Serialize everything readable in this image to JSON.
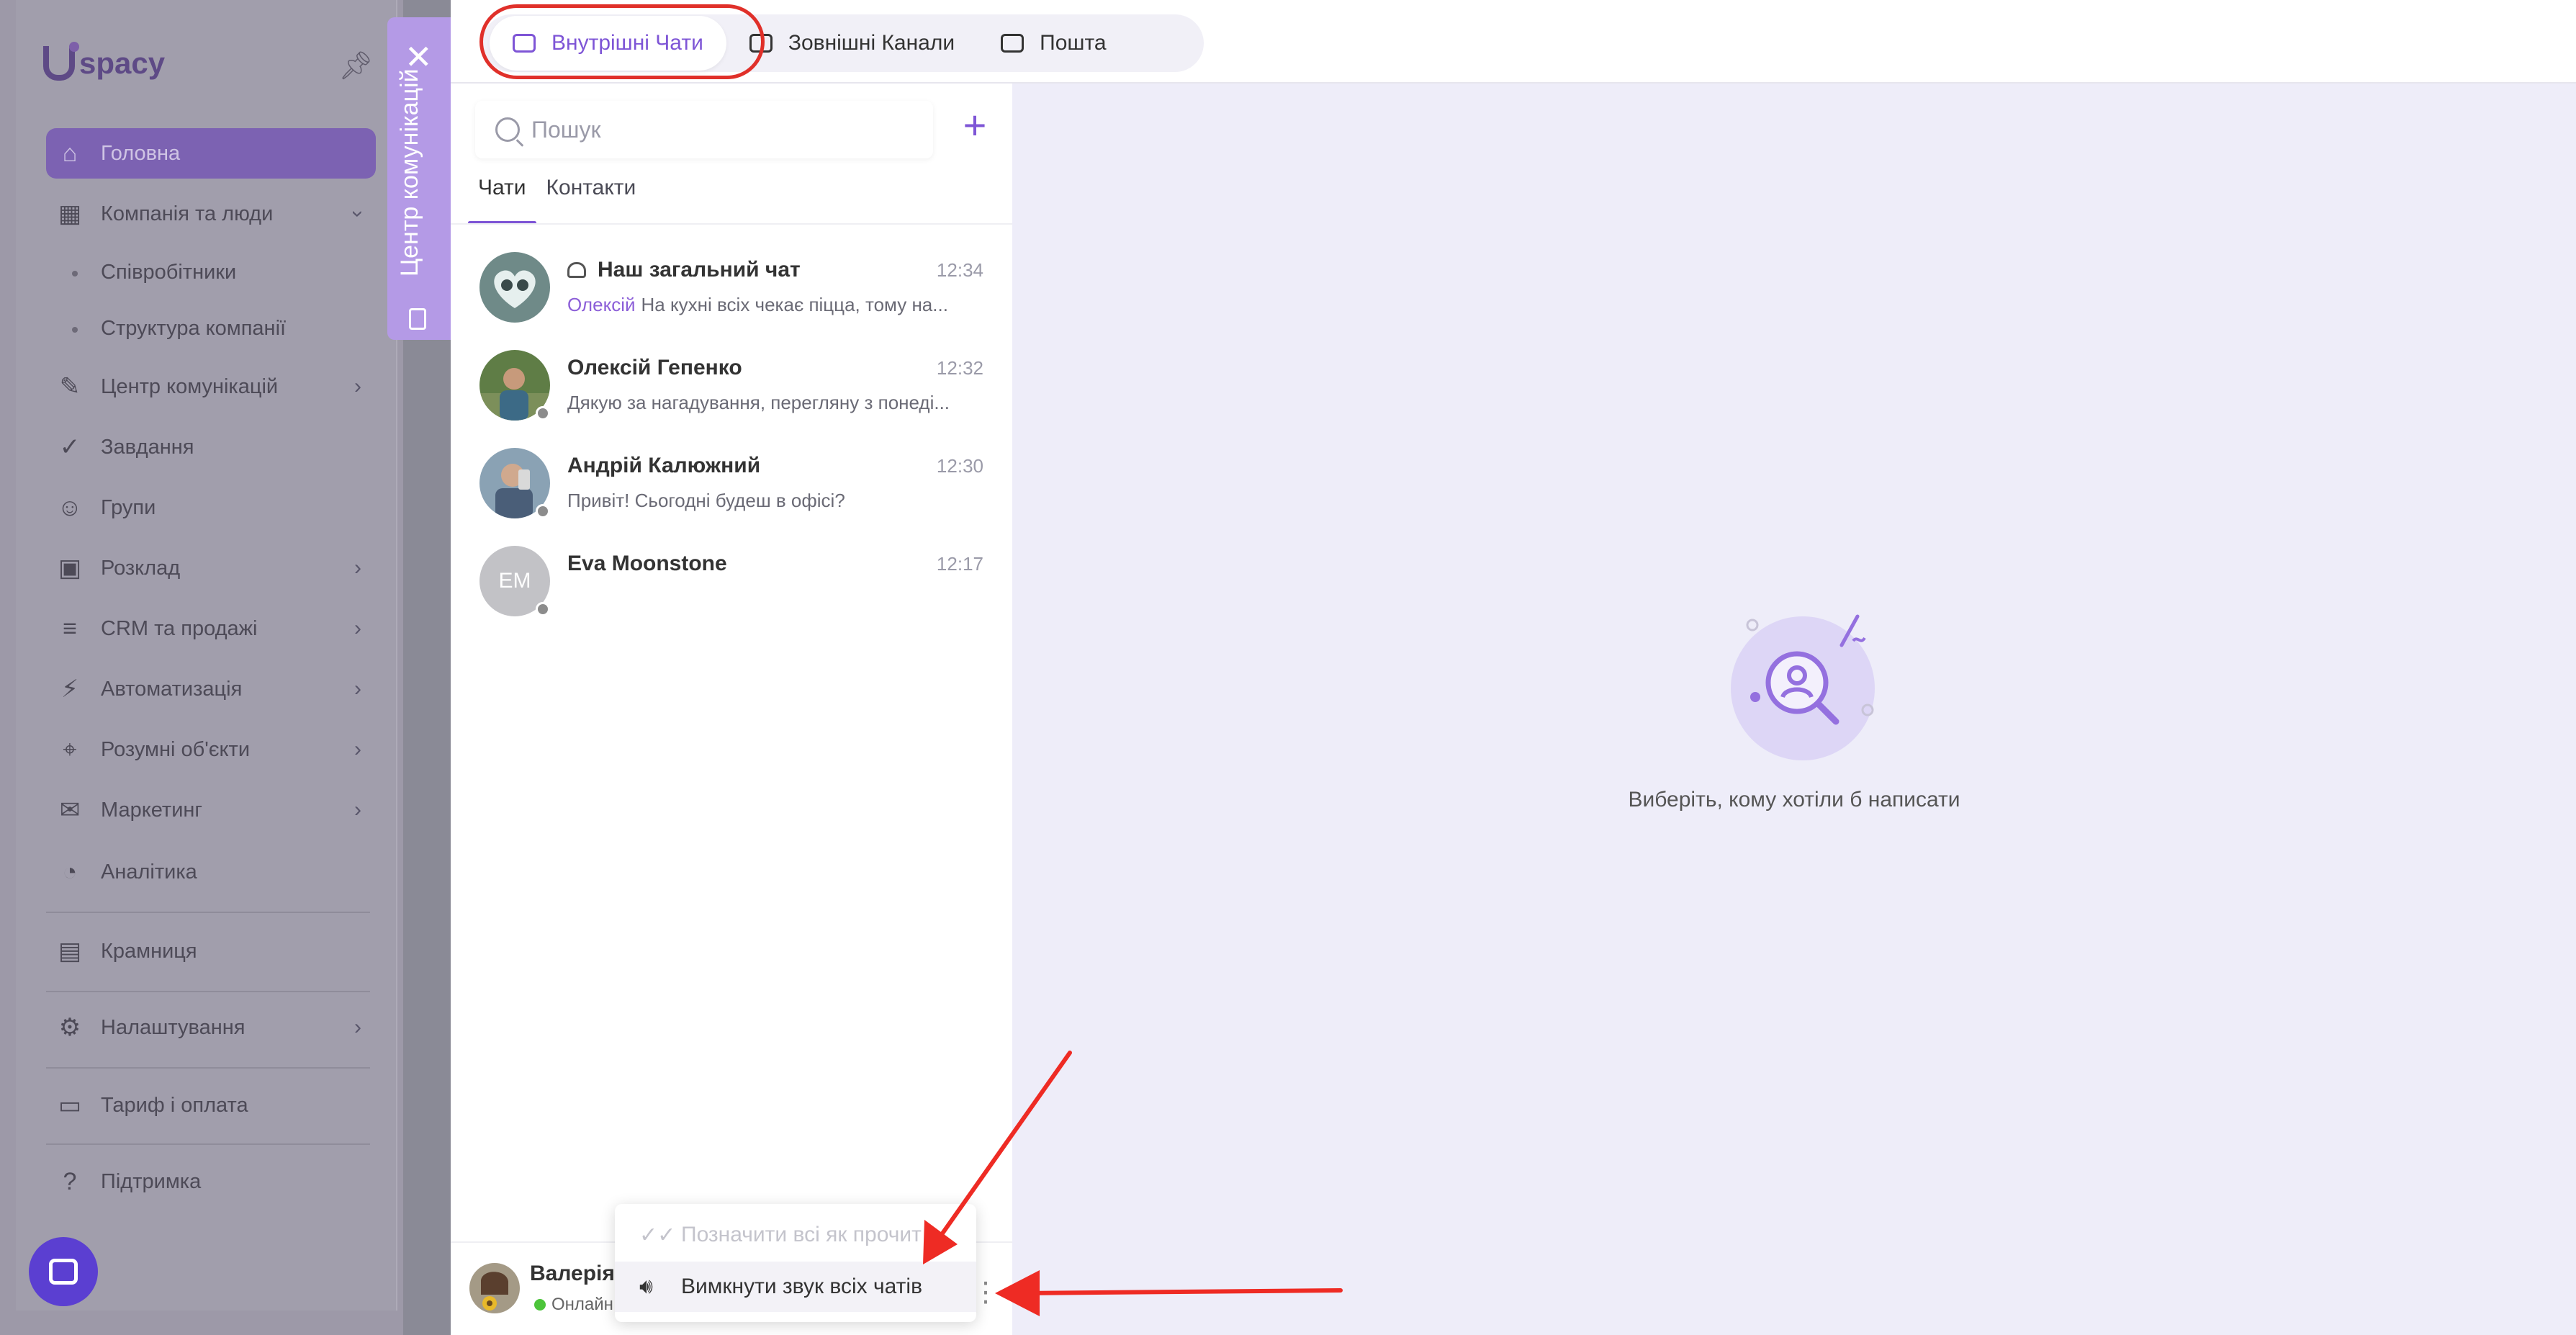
{
  "app": {
    "logo_text": "spacy"
  },
  "sidebar": {
    "items": [
      {
        "label": "Головна",
        "icon": "home-icon"
      },
      {
        "label": "Компанія та люди",
        "icon": "building-icon"
      },
      {
        "label": "Співробітники"
      },
      {
        "label": "Структура компанії"
      },
      {
        "label": "Центр комунікацій",
        "icon": "chat-edit-icon"
      },
      {
        "label": "Завдання",
        "icon": "check-circle-icon"
      },
      {
        "label": "Групи",
        "icon": "users-icon"
      },
      {
        "label": "Розклад",
        "icon": "calendar-icon"
      },
      {
        "label": "CRM та продажі",
        "icon": "database-icon"
      },
      {
        "label": "Автоматизація",
        "icon": "lightning-icon"
      },
      {
        "label": "Розумні об'єкти",
        "icon": "scan-icon"
      },
      {
        "label": "Маркетинг",
        "icon": "megaphone-icon"
      },
      {
        "label": "Аналітика",
        "icon": "chart-icon"
      },
      {
        "label": "Крамниця",
        "icon": "store-icon"
      },
      {
        "label": "Налаштування",
        "icon": "gear-icon"
      },
      {
        "label": "Тариф і оплата",
        "icon": "wallet-icon"
      },
      {
        "label": "Підтримка",
        "icon": "help-icon"
      }
    ]
  },
  "comm_tab": {
    "label": "Центр комунікацій"
  },
  "topbar": {
    "tabs": [
      {
        "label": "Внутрішні Чати",
        "icon": "chat-bubble-icon"
      },
      {
        "label": "Зовнішні Канали",
        "icon": "chats-icon"
      },
      {
        "label": "Пошта",
        "icon": "mail-icon"
      }
    ]
  },
  "chat_panel": {
    "search_placeholder": "Пошук",
    "tabs": [
      "Чати",
      "Контакти"
    ],
    "chats": [
      {
        "name": "Наш загальний чат",
        "time": "12:34",
        "author": "Олексій",
        "preview": "На кухні всіх чекає піцца, тому на...",
        "group": true
      },
      {
        "name": "Олексій Гепенко",
        "time": "12:32",
        "preview": "Дякую за нагадування, перегляну з понеді..."
      },
      {
        "name": "Андрій Калюжний",
        "time": "12:30",
        "preview": "Привіт! Сьогодні будеш в офісі?"
      },
      {
        "name": "Eva Moonstone",
        "time": "12:17",
        "preview": "",
        "initials": "EM"
      }
    ],
    "me": {
      "name": "Валерія",
      "status": "Онлайн"
    },
    "menu": {
      "mark_all_read": "Позначити всі як прочит",
      "mute_all": "Вимкнути звук всіх чатів"
    }
  },
  "main": {
    "empty_text": "Виберіть, кому хотіли б написати"
  },
  "colors": {
    "accent": "#7e55d6",
    "annotation": "#e0302a",
    "online": "#4cc43a"
  }
}
